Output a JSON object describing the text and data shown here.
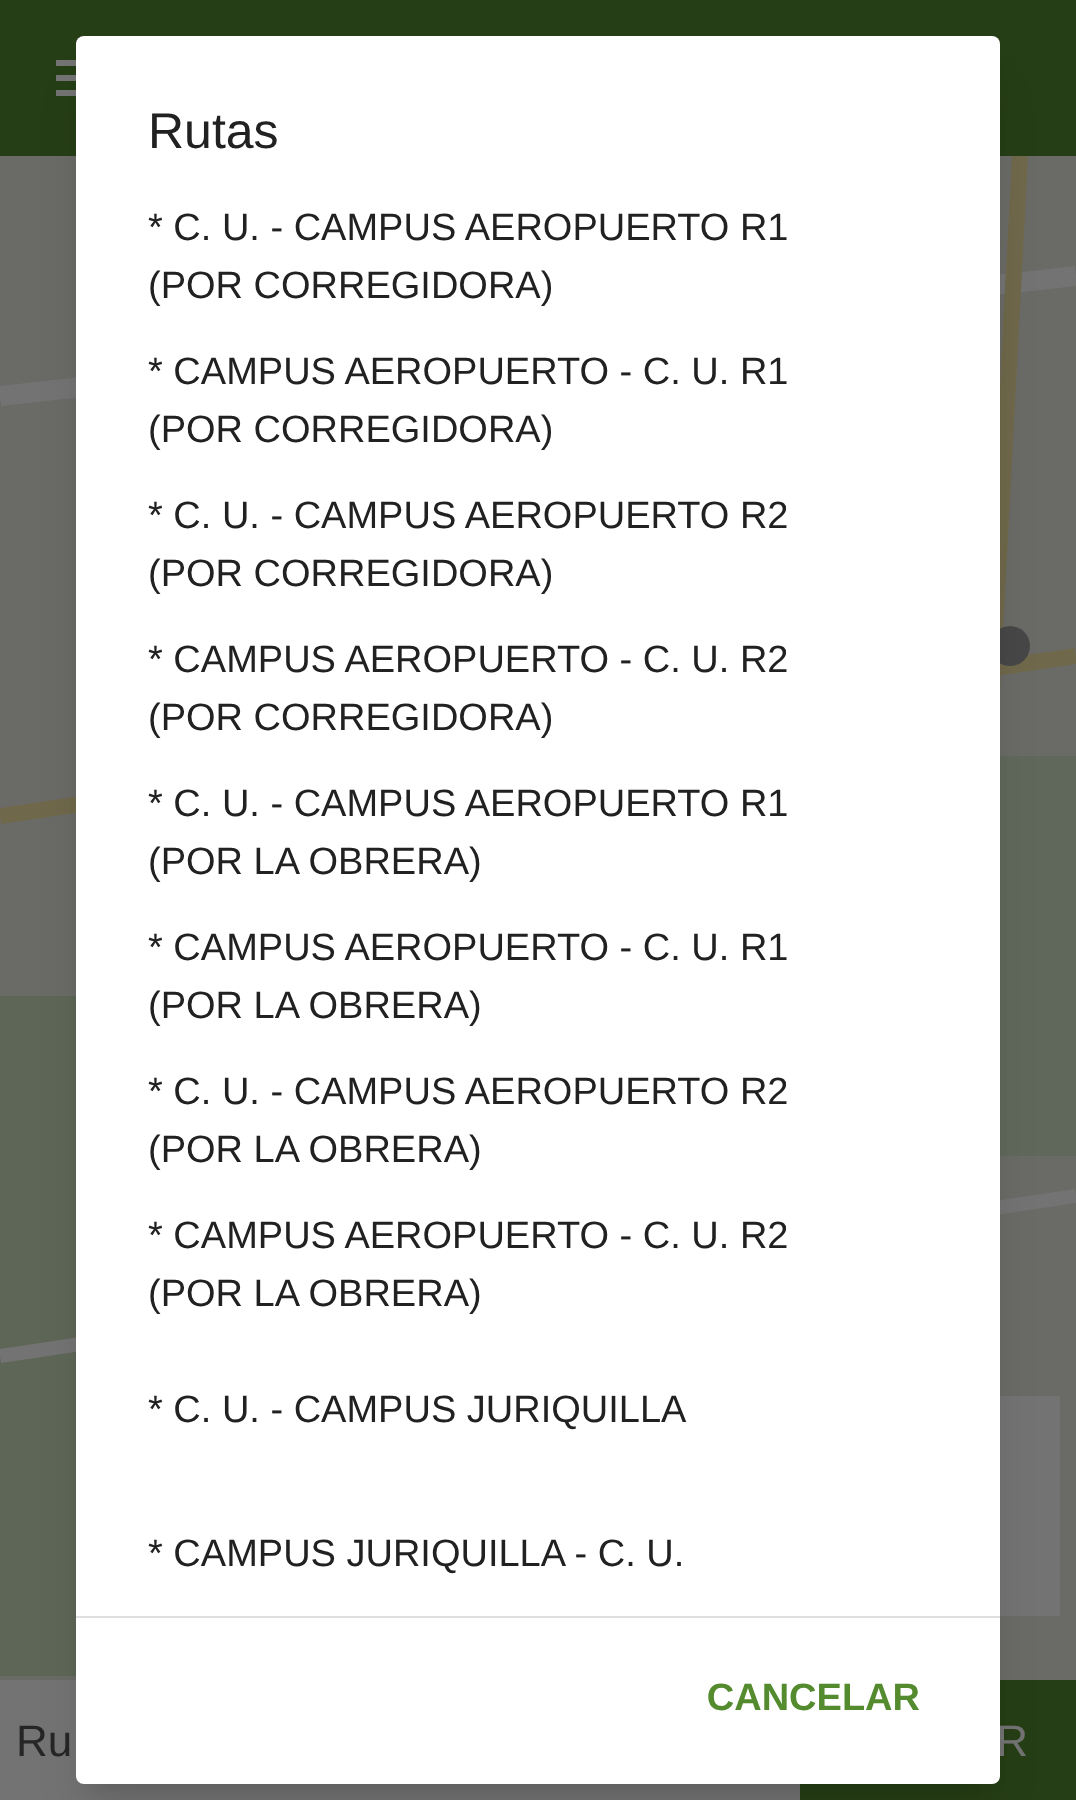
{
  "bottom_bar": {
    "field_value": "Ru",
    "button": "R"
  },
  "dialog": {
    "title": "Rutas",
    "items": [
      {
        "lines": [
          "* C. U. - CAMPUS AEROPUERTO R1",
          "(POR CORREGIDORA)"
        ]
      },
      {
        "lines": [
          "* CAMPUS AEROPUERTO - C. U. R1",
          "(POR CORREGIDORA)"
        ]
      },
      {
        "lines": [
          "* C. U. - CAMPUS AEROPUERTO R2",
          "(POR CORREGIDORA)"
        ]
      },
      {
        "lines": [
          "* CAMPUS AEROPUERTO - C. U. R2",
          "(POR CORREGIDORA)"
        ]
      },
      {
        "lines": [
          "* C. U. - CAMPUS AEROPUERTO R1",
          "(POR LA OBRERA)"
        ]
      },
      {
        "lines": [
          "* CAMPUS AEROPUERTO - C. U. R1",
          "(POR LA OBRERA)"
        ]
      },
      {
        "lines": [
          "* C. U. - CAMPUS AEROPUERTO R2",
          "(POR LA OBRERA)"
        ]
      },
      {
        "lines": [
          "* CAMPUS AEROPUERTO - C. U. R2",
          "(POR LA OBRERA)"
        ]
      },
      {
        "lines": [
          "* C. U. - CAMPUS JURIQUILLA"
        ]
      },
      {
        "lines": [
          "* CAMPUS JURIQUILLA - C. U."
        ]
      }
    ],
    "buttons": [
      "CANCELAR"
    ]
  }
}
